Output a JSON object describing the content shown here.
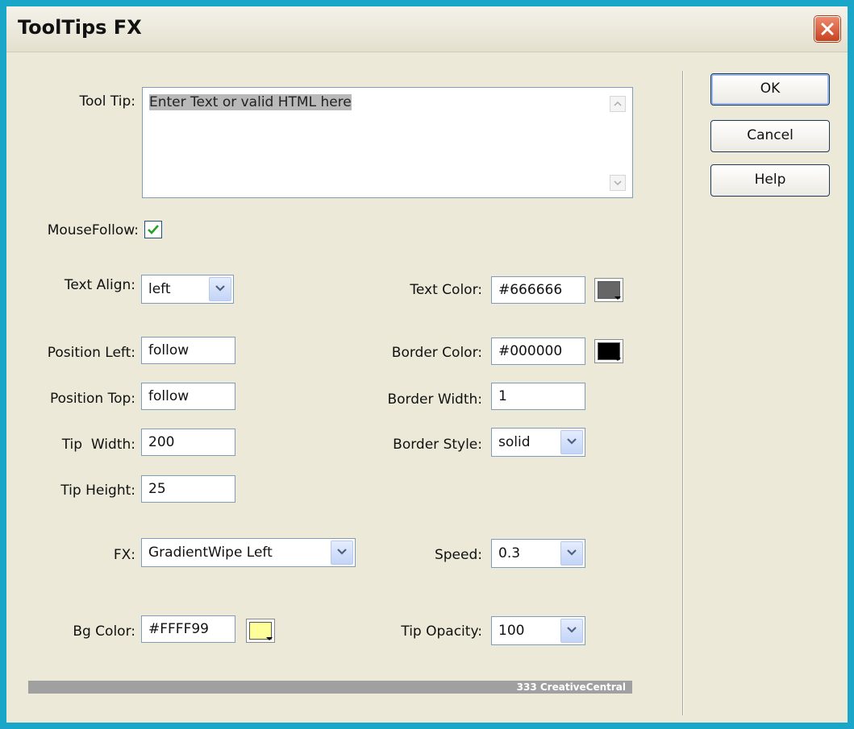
{
  "window": {
    "title": "ToolTips FX"
  },
  "tooltip": {
    "label": "Tool Tip:",
    "text": "Enter Text or valid HTML here"
  },
  "mousefollow": {
    "label": "MouseFollow:",
    "checked": true
  },
  "text_align": {
    "label": "Text Align:",
    "value": "left"
  },
  "text_color": {
    "label": "Text Color:",
    "value": "#666666",
    "swatch": "#666666"
  },
  "position_left": {
    "label": "Position Left:",
    "value": "follow"
  },
  "border_color": {
    "label": "Border Color:",
    "value": "#000000",
    "swatch": "#000000"
  },
  "position_top": {
    "label": "Position Top:",
    "value": "follow"
  },
  "border_width": {
    "label": "Border Width:",
    "value": "1"
  },
  "tip_width": {
    "label": "Tip  Width:",
    "value": "200"
  },
  "border_style": {
    "label": "Border Style:",
    "value": "solid"
  },
  "tip_height": {
    "label": "Tip Height:",
    "value": "25"
  },
  "fx": {
    "label": "FX:",
    "value": "GradientWipe Left"
  },
  "speed": {
    "label": "Speed:",
    "value": "0.3"
  },
  "bg_color": {
    "label": "Bg Color:",
    "value": "#FFFF99",
    "swatch": "#FFFF99"
  },
  "tip_opacity": {
    "label": "Tip Opacity:",
    "value": "100"
  },
  "buttons": {
    "ok": "OK",
    "cancel": "Cancel",
    "help": "Help"
  },
  "brand": "333 CreativeCentral",
  "icons": [
    "close-icon",
    "dropdown-arrow-icon",
    "scroll-up-icon",
    "scroll-down-icon",
    "checkmark-icon",
    "color-picker-arrow-icon"
  ]
}
